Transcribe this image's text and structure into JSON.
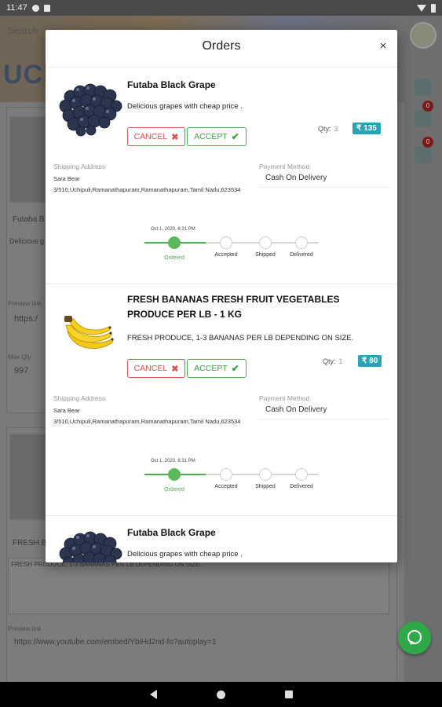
{
  "status_bar": {
    "time": "11:47"
  },
  "background": {
    "search_placeholder": "Search",
    "banner_text": "UCHI",
    "side_badges": [
      "0",
      "0"
    ],
    "items": [
      {
        "name_partial": "Futaba B",
        "desc_partial": "Delicious g",
        "preview_label": "Preview link",
        "preview_value": "https:/",
        "max_qty_label": "Max Qty",
        "max_qty_value": "997"
      },
      {
        "name_partial": "FRESH B",
        "desc_value": "FRESH PRODUCE, 1-3 BANANAS PER LB DEPENDING ON SIZE.",
        "preview_label": "Preview link",
        "preview_value": "https://www.youtube.com/embed/YbiHd2nd-fo?autoplay=1"
      }
    ]
  },
  "modal": {
    "title": "Orders",
    "close_label": "×",
    "orders": [
      {
        "name": "Futaba Black Grape",
        "description": "Delicious grapes with cheap price .",
        "cancel_label": "CANCEL",
        "accept_label": "ACCEPT",
        "qty_label": "Qty:",
        "qty": "3",
        "price": "₹ 135",
        "shipping_label": "Shipping Address",
        "address_name": "Sara Bear",
        "address_line": "3/510,Uchipuli,Ramanathapuram,Ramanathapuram,Tamil Nadu,623534",
        "payment_label": "Payment Method",
        "payment_method": "Cash On Delivery",
        "tracker": {
          "date": "Oct 1, 2020, 8:31 PM",
          "steps": [
            "Ordered",
            "Accepted",
            "Shipped",
            "Delivered"
          ],
          "completed": 1
        }
      },
      {
        "name": "FRESH BANANAS FRESH FRUIT VEGETABLES PRODUCE PER LB - 1 KG",
        "description": "FRESH PRODUCE, 1-3 BANANAS PER LB DEPENDING ON SIZE.",
        "cancel_label": "CANCEL",
        "accept_label": "ACCEPT",
        "qty_label": "Qty:",
        "qty": "1",
        "price": "₹ 80",
        "shipping_label": "Shipping Address",
        "address_name": "Sara Bear",
        "address_line": "3/510,Uchipuli,Ramanathapuram,Ramanathapuram,Tamil Nadu,623534",
        "payment_label": "Payment Method",
        "payment_method": "Cash On Delivery",
        "tracker": {
          "date": "Oct 1, 2020, 8:31 PM",
          "steps": [
            "Ordered",
            "Accepted",
            "Shipped",
            "Delivered"
          ],
          "completed": 1
        }
      },
      {
        "name": "Futaba Black Grape",
        "description": "Delicious grapes with cheap price ."
      }
    ]
  },
  "icons": {
    "cancel": "close-icon",
    "accept": "check-icon",
    "chat": "chat-icon"
  },
  "colors": {
    "accent_price": "#2aa3b5",
    "cancel": "#d9534f",
    "accept": "#4caf50",
    "fab": "#2fa84a"
  }
}
